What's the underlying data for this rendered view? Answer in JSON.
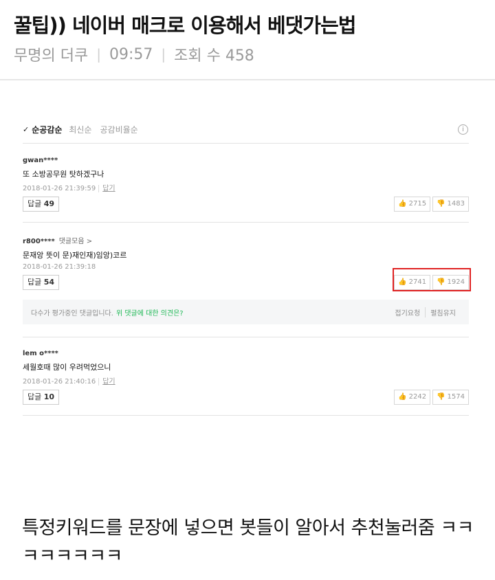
{
  "post": {
    "title": "꿀팁)) 네이버 매크로 이용해서 베댓가는법",
    "author": "무명의 더쿠",
    "time": "09:57",
    "views": "조회 수 458"
  },
  "screenshot": {
    "sort": {
      "active": "순공감순",
      "options": [
        "최신순",
        "공감비율순"
      ]
    },
    "comments": [
      {
        "user": "gwan****",
        "user_extra": "",
        "text": "또 소방공무원 탓하겠구나",
        "date": "2018-01-26 21:39:59",
        "edit": "답기",
        "reply_label": "답글",
        "reply_count": "49",
        "likes": "2715",
        "dislikes": "1483"
      },
      {
        "user": "r800****",
        "user_extra": "댓글모음 >",
        "text": "문재앙 뜻이 문)재인재)임앙)코르",
        "date": "2018-01-26 21:39:18",
        "edit": "",
        "reply_label": "답글",
        "reply_count": "54",
        "likes": "2741",
        "dislikes": "1924"
      },
      {
        "user": "lem o****",
        "user_extra": "",
        "text": "세월호때 많이 우려먹었으니",
        "date": "2018-01-26 21:40:16",
        "edit": "답기",
        "reply_label": "답글",
        "reply_count": "10",
        "likes": "2242",
        "dislikes": "1574"
      }
    ],
    "notice": {
      "message": "다수가 평가중인 댓글입니다.",
      "link": "위 댓글에 대한 의견은?",
      "actions": [
        "접기요청",
        "펼침유지"
      ]
    }
  },
  "caption": "특정키워드를 문장에 넣으면 봇들이 알아서 추천눌러줌 ㅋㅋㅋㅋㅋㅋㅋㅋ",
  "colors": {
    "highlight": "#e02020",
    "link_green": "#1fb856"
  }
}
